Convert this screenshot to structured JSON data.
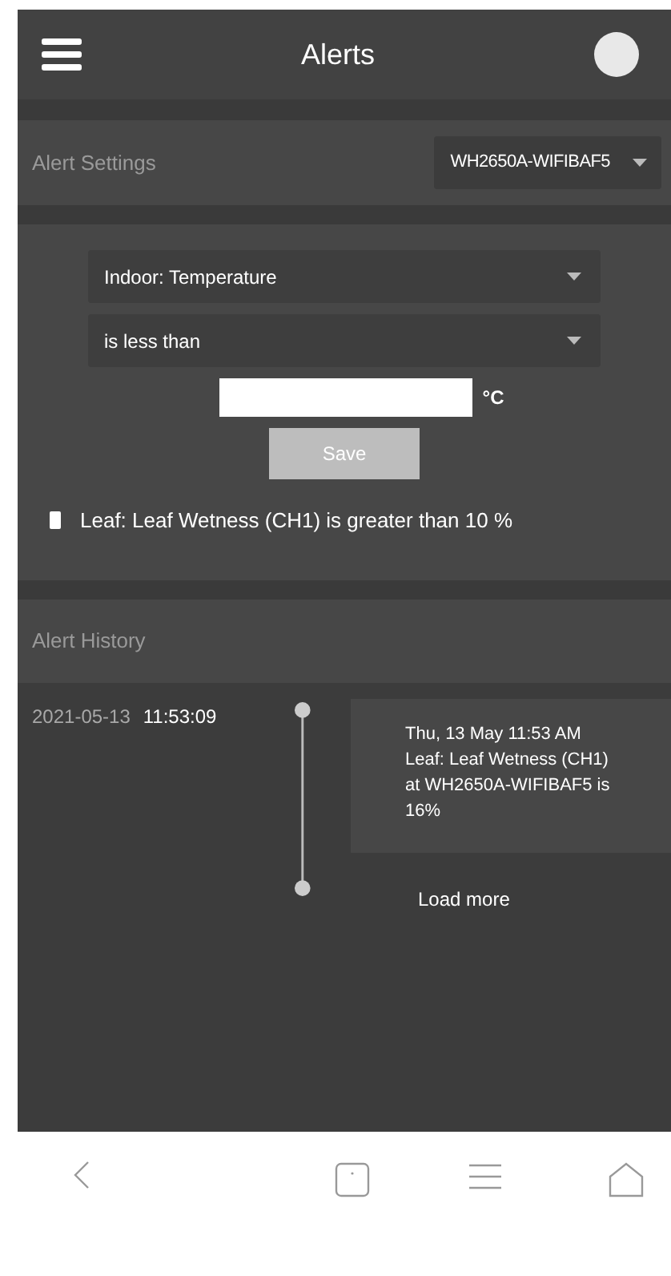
{
  "header": {
    "title": "Alerts"
  },
  "alert_settings": {
    "label": "Alert Settings",
    "device": "WH2650A-WIFIBAF5"
  },
  "form": {
    "sensor": "Indoor: Temperature",
    "condition": "is less than",
    "unit": "°C",
    "save": "Save"
  },
  "alerts": [
    {
      "text": "Leaf: Leaf Wetness (CH1) is greater than 10 %"
    }
  ],
  "alert_history": {
    "label": "Alert History",
    "entries": [
      {
        "date": "2021-05-13",
        "time": "11:53:09",
        "message_lines": [
          "Thu, 13 May 11:53 AM",
          "Leaf: Leaf Wetness (CH1)",
          "at WH2650A-WIFIBAF5 is",
          "16%"
        ]
      }
    ],
    "load_more": "Load more"
  }
}
